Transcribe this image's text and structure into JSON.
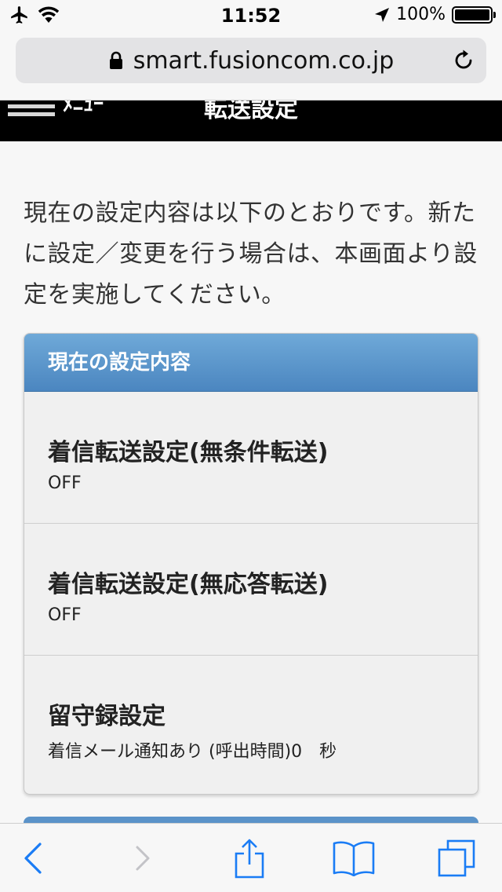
{
  "status_bar": {
    "time": "11:52",
    "battery": "100%"
  },
  "browser": {
    "url": "smart.fusioncom.co.jp"
  },
  "header": {
    "back_label": "ﾒﾆｭｰ",
    "title": "転送設定"
  },
  "intro_text": "現在の設定内容は以下のとおりです。新たに設定／変更を行う場合は、本画面より設定を実施してください。",
  "settings_card": {
    "title": "現在の設定内容",
    "items": [
      {
        "label": "着信転送設定(無条件転送)",
        "value": "OFF"
      },
      {
        "label": "着信転送設定(無応答転送)",
        "value": "OFF"
      },
      {
        "label": "留守録設定",
        "value": "着信メール通知あり (呼出時間)0　秒"
      }
    ]
  },
  "colors": {
    "accent": "#1a7cf5",
    "card_header_top": "#6fa9d8",
    "card_header_bottom": "#4b86c0",
    "disabled": "#c3c3c7"
  },
  "icons": {
    "airplane": "airplane-icon",
    "wifi": "wifi-icon",
    "location": "location-arrow-icon",
    "lock": "lock-icon",
    "reload": "reload-icon",
    "back": "chevron-left-icon",
    "forward": "chevron-right-icon",
    "share": "share-icon",
    "bookmarks": "bookmarks-icon",
    "tabs": "tabs-icon"
  }
}
